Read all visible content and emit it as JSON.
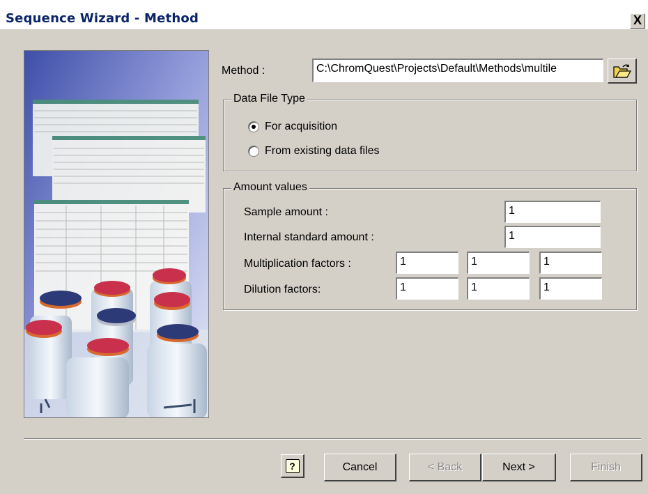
{
  "window": {
    "title": "Sequence Wizard - Method",
    "close_label": "X"
  },
  "method": {
    "label": "Method :",
    "value": "C:\\ChromQuest\\Projects\\Default\\Methods\\multile"
  },
  "data_file_type": {
    "title": "Data File Type",
    "options": [
      {
        "label": "For acquisition",
        "selected": true
      },
      {
        "label": "From existing data files",
        "selected": false
      }
    ]
  },
  "amount_values": {
    "title": "Amount values",
    "sample_amount": {
      "label": "Sample amount :",
      "value": "1"
    },
    "internal_standard_amount": {
      "label": "Internal standard amount :",
      "value": "1"
    },
    "multiplication_factors": {
      "label": "Multiplication factors :",
      "values": [
        "1",
        "1",
        "1"
      ]
    },
    "dilution_factors": {
      "label": "Dilution factors:",
      "values": [
        "1",
        "1",
        "1"
      ]
    }
  },
  "buttons": {
    "help": "?",
    "cancel": "Cancel",
    "back": "< Back",
    "next": "Next >",
    "finish": "Finish"
  },
  "colors": {
    "title_text": "#0a246a",
    "dialog_bg": "#d4d0c8"
  }
}
